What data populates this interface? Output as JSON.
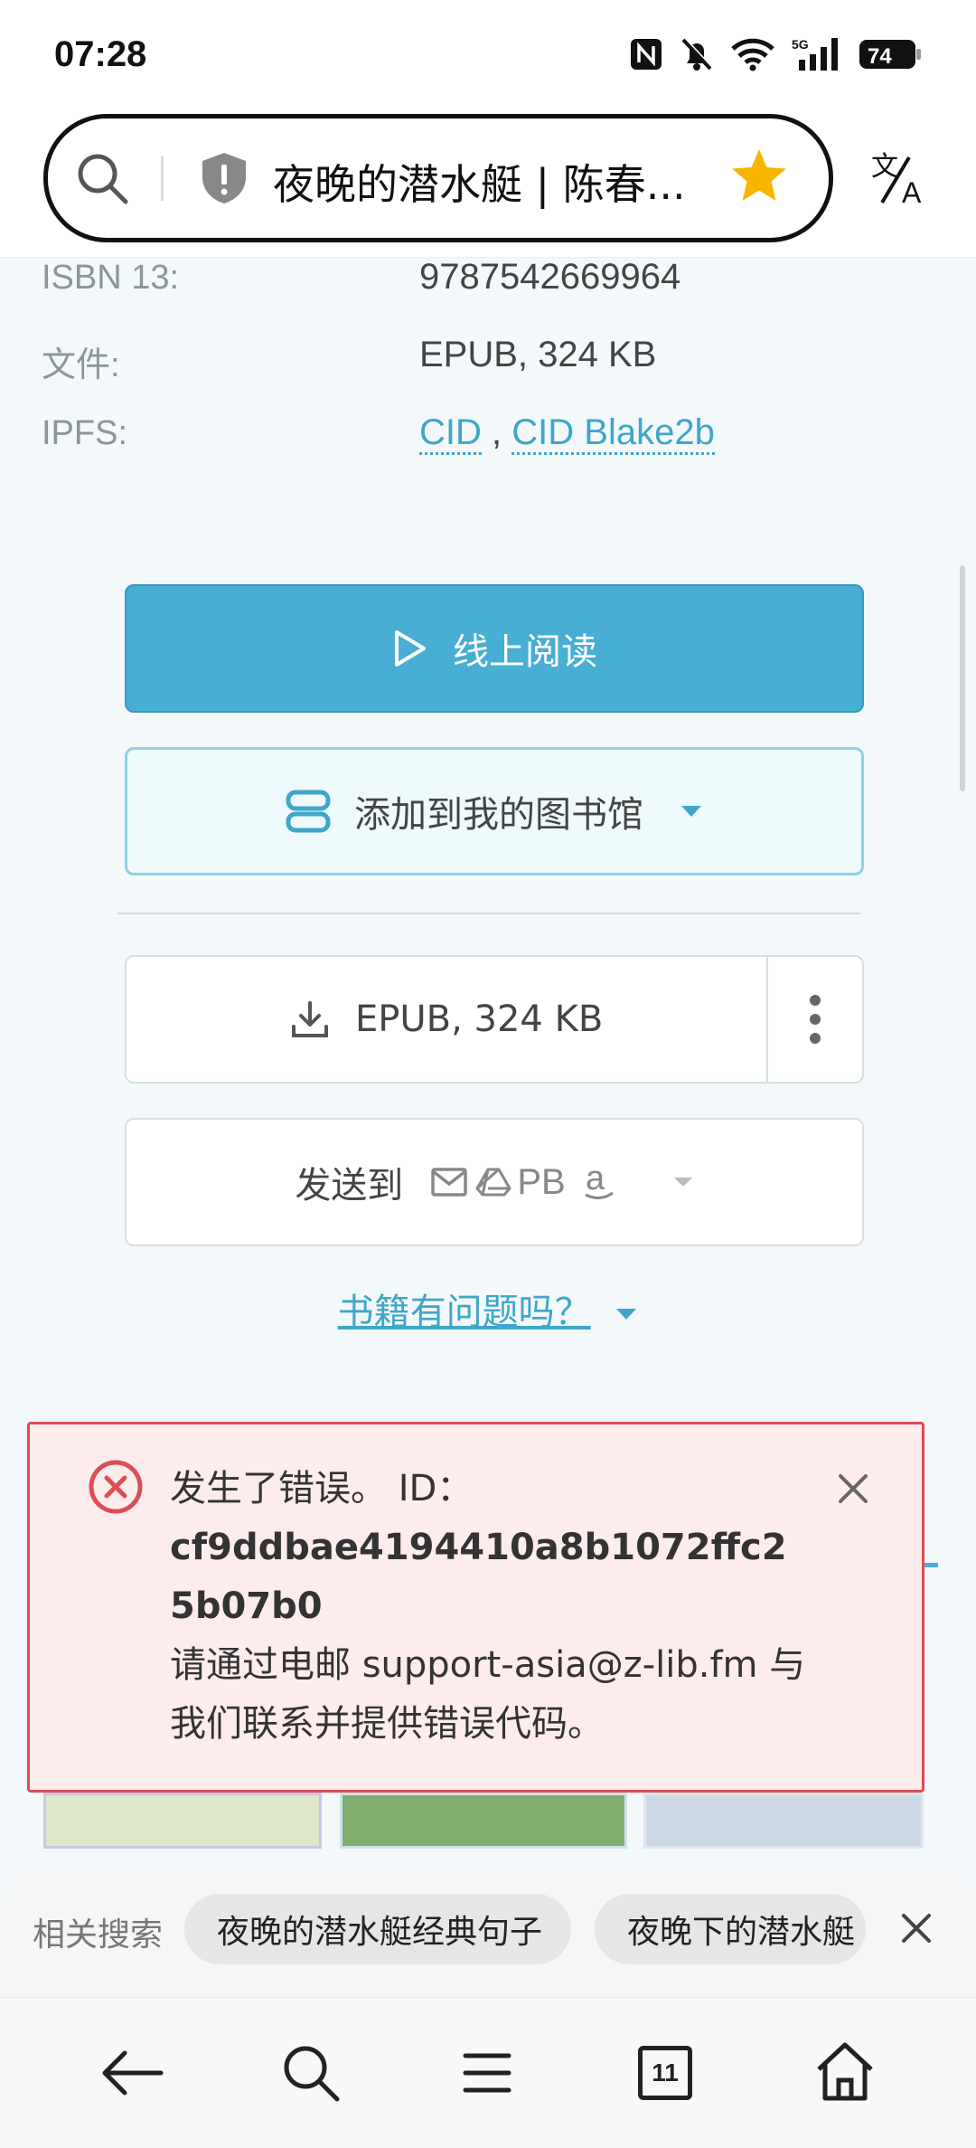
{
  "status_bar": {
    "time": "07:28",
    "battery": "74",
    "network": "5G"
  },
  "address_bar": {
    "title": "夜晚的潜水艇 | 陈春..."
  },
  "info": [
    {
      "label": "ISBN 13:",
      "value": "9787542669964"
    },
    {
      "label": "文件:",
      "value": "EPUB, 324 KB"
    },
    {
      "label": "IPFS:",
      "links": [
        "CID",
        "CID Blake2b"
      ],
      "separator": ","
    }
  ],
  "actions": {
    "read_online": "线上阅读",
    "add_library": "添加到我的图书馆",
    "download": "EPUB, 324 KB",
    "send_to": "发送到",
    "send_pb": "PB",
    "problem": "书籍有问题吗？"
  },
  "error": {
    "title": "发生了错误。 ID：",
    "code": "cf9ddbae4194410a8b1072ffc25b07b0",
    "message": "请通过电邮 support-asia@z-lib.fm 与我们联系并提供错误代码。"
  },
  "related": {
    "label": "相关搜索",
    "chips": [
      "夜晚的潜水艇经典句子",
      "夜晚下的潜水艇"
    ]
  },
  "bottom_nav": {
    "tab_count": "11"
  },
  "colors": {
    "accent": "#48aed3",
    "error_border": "#dc4e56",
    "error_bg": "#fdecec",
    "star": "#f7b500"
  }
}
